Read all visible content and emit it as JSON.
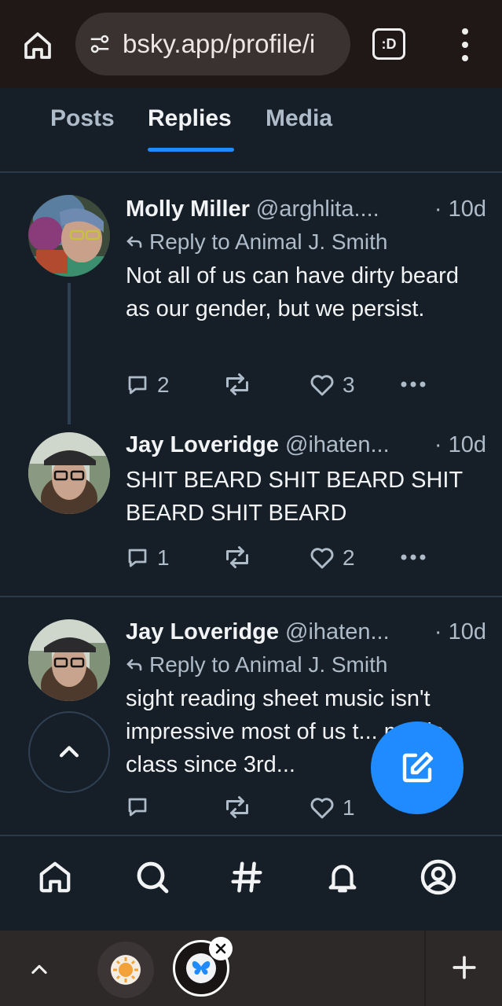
{
  "browser": {
    "url": "bsky.app/profile/i",
    "extension_label": ":D"
  },
  "tabs": [
    {
      "label": "Posts"
    },
    {
      "label": "Replies"
    },
    {
      "label": "Media"
    }
  ],
  "posts": [
    {
      "name": "Molly Miller",
      "handle": "@arghlita....",
      "time": "· 10d",
      "reply_to": "Reply to Animal J. Smith",
      "text": "Not all of us can have dirty beard as our gender, but we persist.",
      "replies": "2",
      "likes": "3"
    },
    {
      "name": "Jay Loveridge",
      "handle": "@ihaten...",
      "time": "· 10d",
      "text": "SHIT BEARD SHIT BEARD SHIT BEARD SHIT BEARD",
      "replies": "1",
      "likes": "2"
    },
    {
      "name": "Jay Loveridge",
      "handle": "@ihaten...",
      "time": "· 10d",
      "reply_to": "Reply to Animal J. Smith",
      "text": "sight reading sheet music isn't impressive most of us t... music class since 3rd...",
      "replies": "",
      "likes": "1"
    }
  ],
  "colors": {
    "accent": "#208bfe",
    "background": "#161e27",
    "muted_text": "#aebbc9"
  }
}
